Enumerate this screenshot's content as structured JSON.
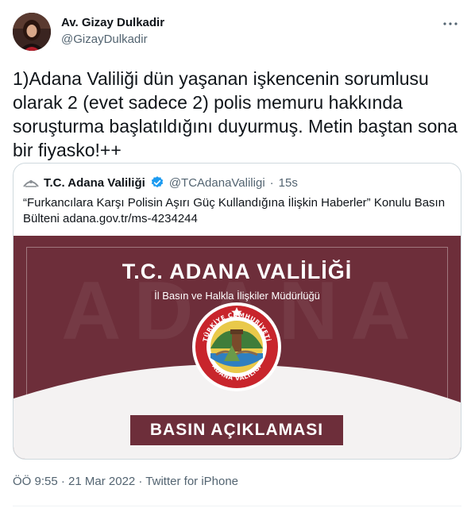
{
  "author": {
    "name": "Av. Gizay Dulkadir",
    "handle": "@GizayDulkadir"
  },
  "tweet": {
    "text": "1)Adana Valiliği dün yaşanan işkencenin sorumlusu\nolarak 2 (evet sadece 2) polis memuru hakkında\nsoruşturma başlatıldığını duyurmuş. Metin baştan sona\nbir fiyasko!++"
  },
  "quoted": {
    "name": "T.C. Adana Valiliği",
    "handle": "@TCAdanaValiligi",
    "separator": "·",
    "time": "15s",
    "text": "“Furkancılara Karşı Polisin Aşırı Güç Kullandığına İlişkin Haberler” Konulu Basın Bülteni adana.gov.tr/ms-4234244",
    "media": {
      "title": "T.C. ADANA VALİLİĞİ",
      "subtitle": "İl Basın ve Halkla İlişkiler Müdürlüğü",
      "watermark": "ADANA",
      "badge": "BASIN AÇIKLAMASI",
      "seal_top": "TÜRKİYE CUMHURİYETİ",
      "seal_bottom": "ADANA VALİLİĞİ"
    }
  },
  "meta": {
    "timestamp": "ÖÖ 9:55 · 21 Mar 2022 · Twitter for iPhone"
  },
  "icons": {
    "more": "more-horizontal-icon",
    "verified": "verified-badge-icon",
    "quote_avatar": "government-emblem-icon"
  },
  "colors": {
    "verified_blue": "#1d9bf0",
    "media_maroon": "#6d2e3a",
    "secondary_text": "#536471"
  }
}
